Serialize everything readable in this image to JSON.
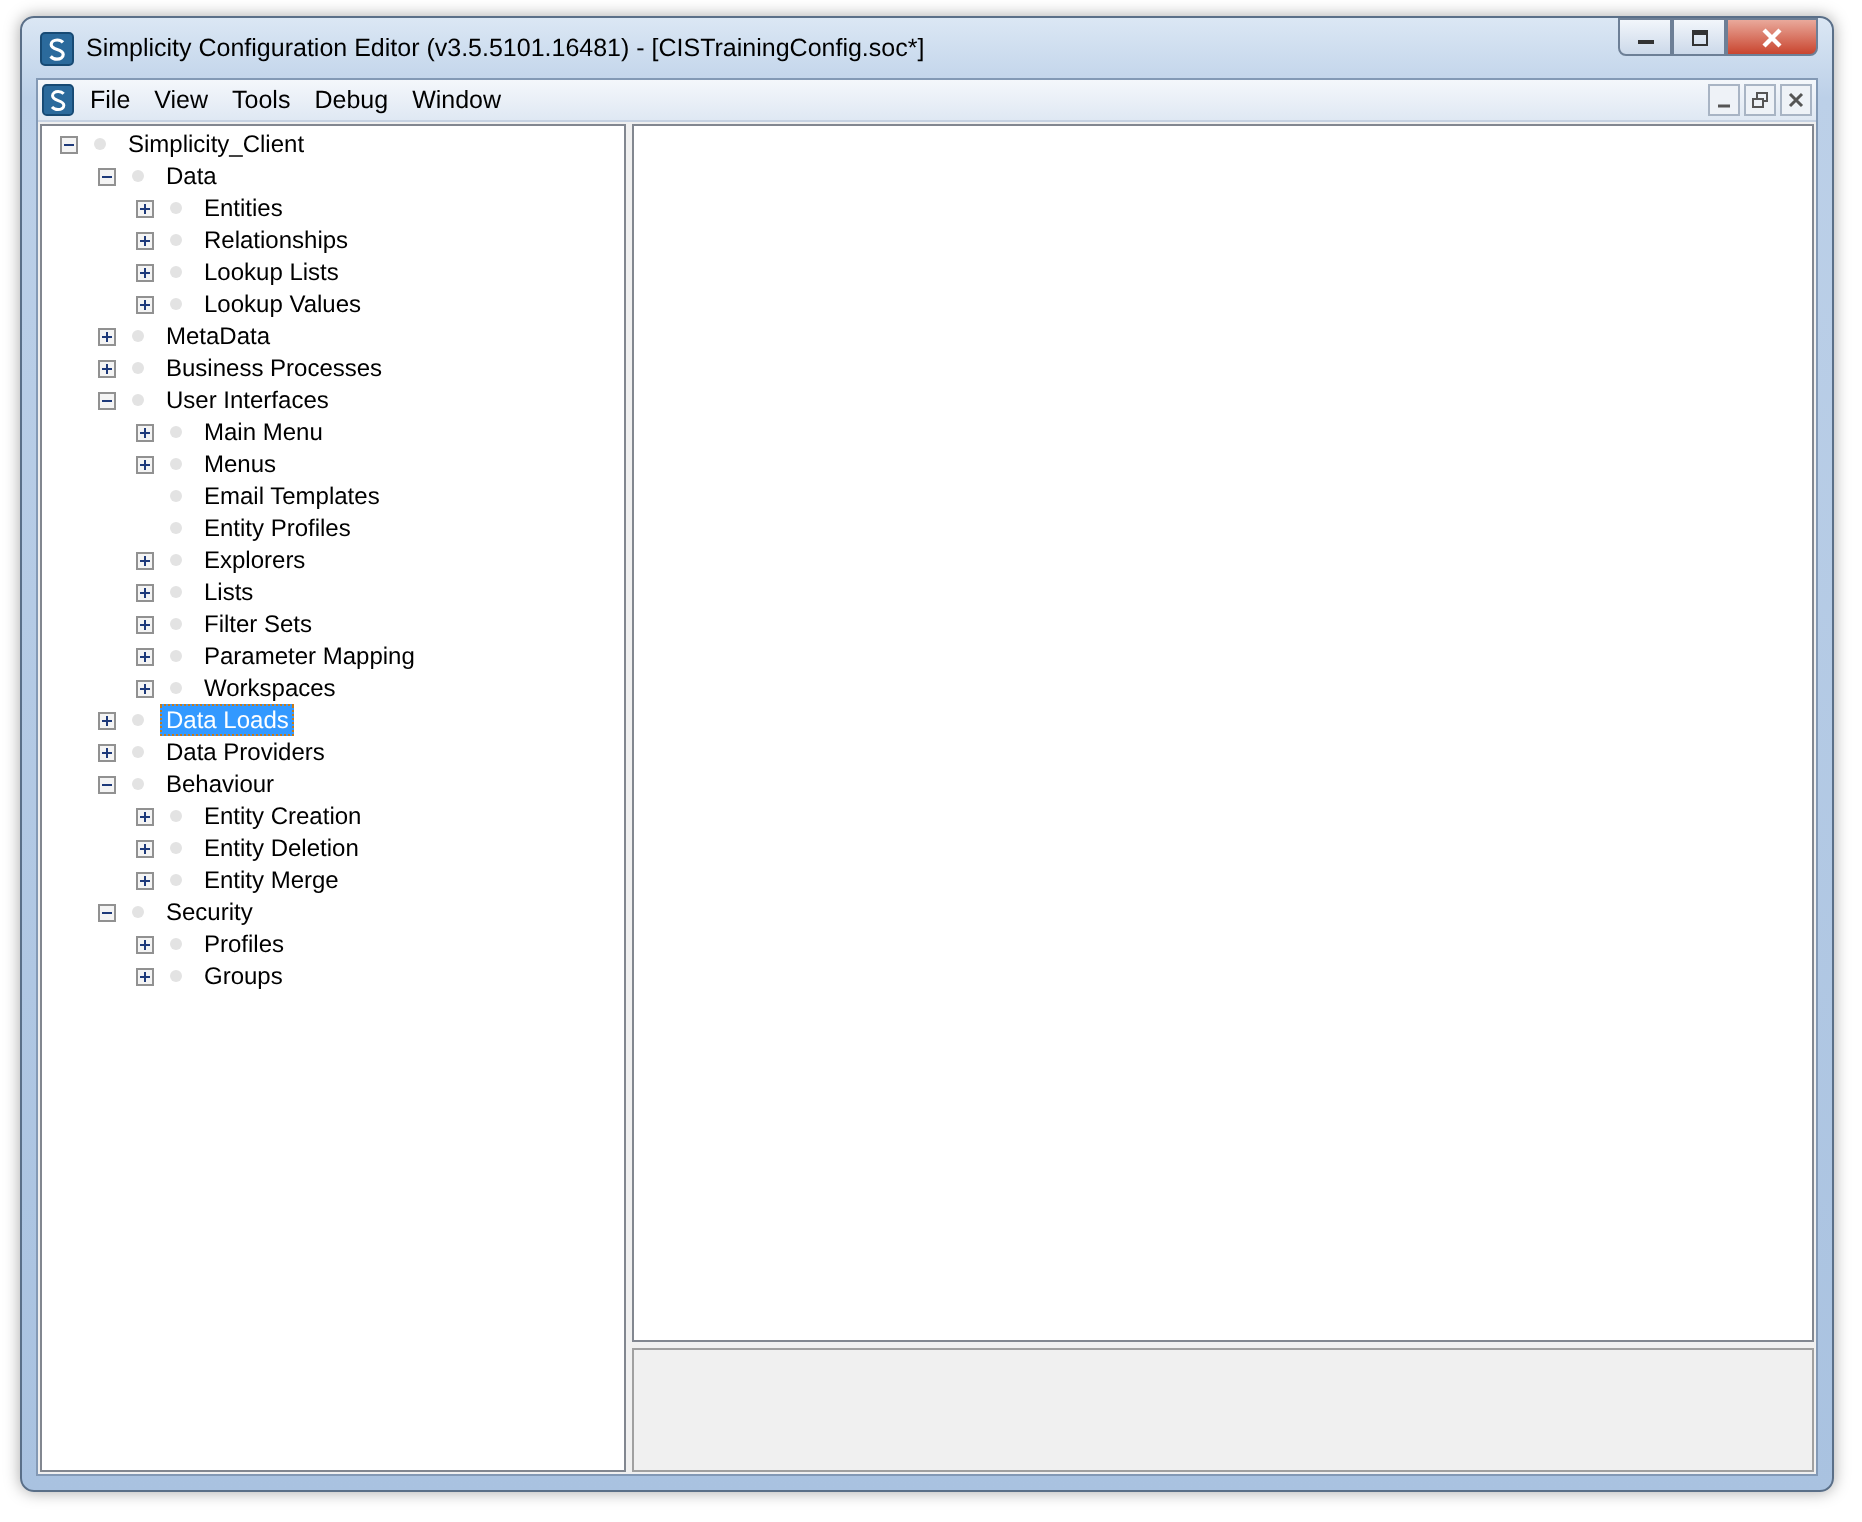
{
  "window": {
    "title": "Simplicity Configuration Editor (v3.5.5101.16481) - [CISTrainingConfig.soc*]"
  },
  "menu": [
    "File",
    "View",
    "Tools",
    "Debug",
    "Window"
  ],
  "tree": [
    {
      "label": "Simplicity_Client",
      "expanded": true,
      "selected": false,
      "children": [
        {
          "label": "Data",
          "expanded": true,
          "selected": false,
          "children": [
            {
              "label": "Entities",
              "expanded": false,
              "selected": false
            },
            {
              "label": "Relationships",
              "expanded": false,
              "selected": false
            },
            {
              "label": "Lookup Lists",
              "expanded": false,
              "selected": false
            },
            {
              "label": "Lookup Values",
              "expanded": false,
              "selected": false
            }
          ]
        },
        {
          "label": "MetaData",
          "expanded": false,
          "selected": false
        },
        {
          "label": "Business Processes",
          "expanded": false,
          "selected": false
        },
        {
          "label": "User Interfaces",
          "expanded": true,
          "selected": false,
          "children": [
            {
              "label": "Main Menu",
              "expanded": false,
              "selected": false
            },
            {
              "label": "Menus",
              "expanded": false,
              "selected": false
            },
            {
              "label": "Email Templates",
              "selected": false
            },
            {
              "label": "Entity Profiles",
              "selected": false
            },
            {
              "label": "Explorers",
              "expanded": false,
              "selected": false
            },
            {
              "label": "Lists",
              "expanded": false,
              "selected": false
            },
            {
              "label": "Filter Sets",
              "expanded": false,
              "selected": false
            },
            {
              "label": "Parameter Mapping",
              "expanded": false,
              "selected": false
            },
            {
              "label": "Workspaces",
              "expanded": false,
              "selected": false
            }
          ]
        },
        {
          "label": "Data Loads",
          "expanded": false,
          "selected": true
        },
        {
          "label": "Data Providers",
          "expanded": false,
          "selected": false
        },
        {
          "label": "Behaviour",
          "expanded": true,
          "selected": false,
          "children": [
            {
              "label": "Entity Creation",
              "expanded": false,
              "selected": false
            },
            {
              "label": "Entity Deletion",
              "expanded": false,
              "selected": false
            },
            {
              "label": "Entity Merge",
              "expanded": false,
              "selected": false
            }
          ]
        },
        {
          "label": "Security",
          "expanded": true,
          "selected": false,
          "children": [
            {
              "label": "Profiles",
              "expanded": false,
              "selected": false
            },
            {
              "label": "Groups",
              "expanded": false,
              "selected": false
            }
          ]
        }
      ]
    }
  ]
}
